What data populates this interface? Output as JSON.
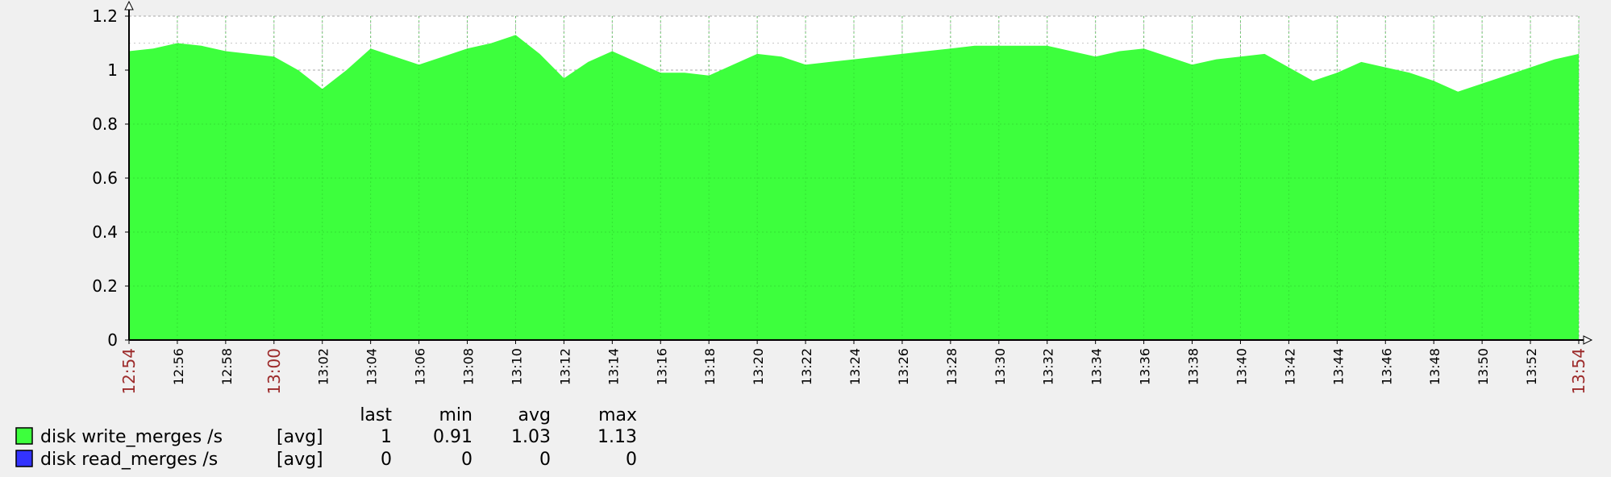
{
  "chart_data": {
    "type": "area",
    "title": "",
    "xlabel": "",
    "ylabel": "",
    "ylim": [
      0,
      1.2
    ],
    "y_ticks": [
      "0",
      "0.2",
      "0.4",
      "0.6",
      "0.8",
      "1",
      "1.2"
    ],
    "x_tick_labels": [
      "12:54",
      "12:56",
      "12:58",
      "13:00",
      "13:02",
      "13:04",
      "13:06",
      "13:08",
      "13:10",
      "13:12",
      "13:14",
      "13:16",
      "13:18",
      "13:20",
      "13:22",
      "13:24",
      "13:26",
      "13:28",
      "13:30",
      "13:32",
      "13:34",
      "13:36",
      "13:38",
      "13:40",
      "13:42",
      "13:44",
      "13:46",
      "13:48",
      "13:50",
      "13:52",
      "13:54"
    ],
    "x_tick_highlight": [
      "12:54",
      "13:00",
      "13:54"
    ],
    "grid": true,
    "series": [
      {
        "name": "disk write_merges /s",
        "color": "#3dff3d",
        "x": [
          "12:54",
          "12:55",
          "12:56",
          "12:57",
          "12:58",
          "12:59",
          "13:00",
          "13:01",
          "13:02",
          "13:03",
          "13:04",
          "13:05",
          "13:06",
          "13:07",
          "13:08",
          "13:09",
          "13:10",
          "13:11",
          "13:12",
          "13:13",
          "13:14",
          "13:15",
          "13:16",
          "13:17",
          "13:18",
          "13:19",
          "13:20",
          "13:21",
          "13:22",
          "13:23",
          "13:24",
          "13:25",
          "13:26",
          "13:27",
          "13:28",
          "13:29",
          "13:30",
          "13:31",
          "13:32",
          "13:33",
          "13:34",
          "13:35",
          "13:36",
          "13:37",
          "13:38",
          "13:39",
          "13:40",
          "13:41",
          "13:42",
          "13:43",
          "13:44",
          "13:45",
          "13:46",
          "13:47",
          "13:48",
          "13:49",
          "13:50",
          "13:51",
          "13:52",
          "13:53",
          "13:54"
        ],
        "values": [
          1.07,
          1.08,
          1.1,
          1.09,
          1.07,
          1.06,
          1.05,
          1.0,
          0.93,
          1.0,
          1.08,
          1.05,
          1.02,
          1.05,
          1.08,
          1.1,
          1.13,
          1.06,
          0.97,
          1.03,
          1.07,
          1.03,
          0.99,
          0.99,
          0.98,
          1.02,
          1.06,
          1.05,
          1.02,
          1.03,
          1.04,
          1.05,
          1.06,
          1.07,
          1.08,
          1.09,
          1.09,
          1.09,
          1.09,
          1.07,
          1.05,
          1.07,
          1.08,
          1.05,
          1.02,
          1.04,
          1.05,
          1.06,
          1.01,
          0.96,
          0.99,
          1.03,
          1.01,
          0.99,
          0.96,
          0.92,
          0.95,
          0.98,
          1.01,
          1.04,
          1.06
        ]
      },
      {
        "name": "disk read_merges /s",
        "color": "#3333ff",
        "values": []
      }
    ]
  },
  "legend": {
    "headers": [
      "last",
      "min",
      "avg",
      "max"
    ],
    "rows": [
      {
        "name": "disk write_merges /s",
        "func": "[avg]",
        "last": "1",
        "min": "0.91",
        "avg": "1.03",
        "max": "1.13",
        "color": "#3dff3d"
      },
      {
        "name": "disk read_merges /s",
        "func": "[avg]",
        "last": "0",
        "min": "0",
        "avg": "0",
        "max": "0",
        "color": "#3333ff"
      }
    ]
  }
}
